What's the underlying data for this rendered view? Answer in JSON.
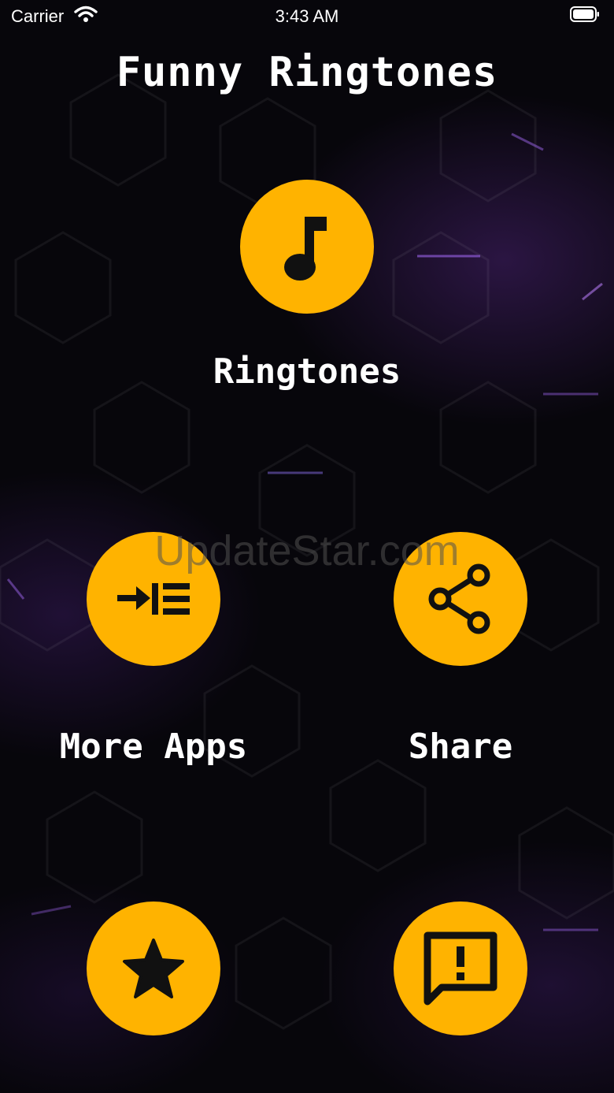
{
  "status_bar": {
    "carrier": "Carrier",
    "time": "3:43 AM"
  },
  "app": {
    "title": "Funny Ringtones"
  },
  "menu": {
    "ringtones": {
      "label": "Ringtones",
      "icon": "music-note-icon"
    },
    "more_apps": {
      "label": "More Apps",
      "icon": "indent-list-icon"
    },
    "share": {
      "label": "Share",
      "icon": "share-icon"
    },
    "rate": {
      "icon": "star-icon"
    },
    "feedback": {
      "icon": "feedback-alert-icon"
    }
  },
  "watermark": "UpdateStar.com",
  "colors": {
    "accent": "#ffb300",
    "background": "#07060b",
    "icon": "#111111",
    "text": "#ffffff"
  }
}
